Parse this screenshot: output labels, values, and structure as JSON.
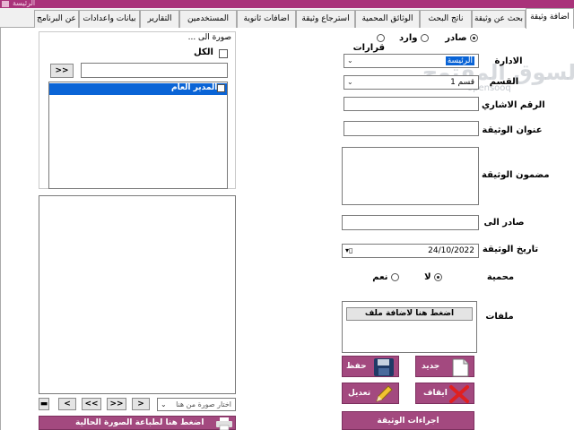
{
  "window": {
    "title": "الرئيسة"
  },
  "tabs": [
    "اضافة وثيقة",
    "بحث عن وثيقة",
    "ناتج البحث",
    "الوثائق المحمية",
    "استرجاع وثيقة",
    "اضافات ثانوية",
    "المستخدمين",
    "التقارير",
    "بيانات واعدادات",
    "عن البرنامج"
  ],
  "form": {
    "type_options": [
      "صادر",
      "وارد",
      "قرارات"
    ],
    "type_selected": "صادر",
    "admin_label": "الادارة",
    "admin_value": "الرئيسة",
    "dept_label": "القسم",
    "dept_value": "قسم 1",
    "ref_label": "الرقم الاشاري",
    "ref_value": "",
    "title_label": "عنوان الوثيقة",
    "title_value": "",
    "content_label": "مضمون الوثيقة",
    "content_value": "",
    "issued_to_label": "صادر الى",
    "issued_to_value": "",
    "date_label": "تاريخ الوثيقة",
    "date_value": "24/10/2022",
    "protected_label": "محمية",
    "protected_options": [
      "لا",
      "نعم"
    ],
    "protected_selected": "لا",
    "attachments_label": "ملفات",
    "add_file_label": "اضغط هنا لاضافة ملف"
  },
  "actions": {
    "new": "جديد",
    "save": "حفظ",
    "stop": "ايقاف",
    "edit": "تعديل",
    "procedures": "اجراءات الوثيقة"
  },
  "recipients": {
    "copy_to_label": "صورة الى ...",
    "all_label": "الكل",
    "search_value": "",
    "add_button": ">>",
    "items": [
      "المدير العام"
    ]
  },
  "image_panel": {
    "select_placeholder": "اختار صورة من هنا",
    "nav": [
      "<",
      "<<",
      ">>",
      ">"
    ],
    "print_label": "اضغط هنا لطباعة الصورة الحالية"
  },
  "watermark": {
    "text": "السوق المفتوح",
    "domain": "opensooq"
  },
  "colors": {
    "accent": "#a3497f",
    "titlebar": "#a9337a",
    "selection": "#0a64d6"
  }
}
